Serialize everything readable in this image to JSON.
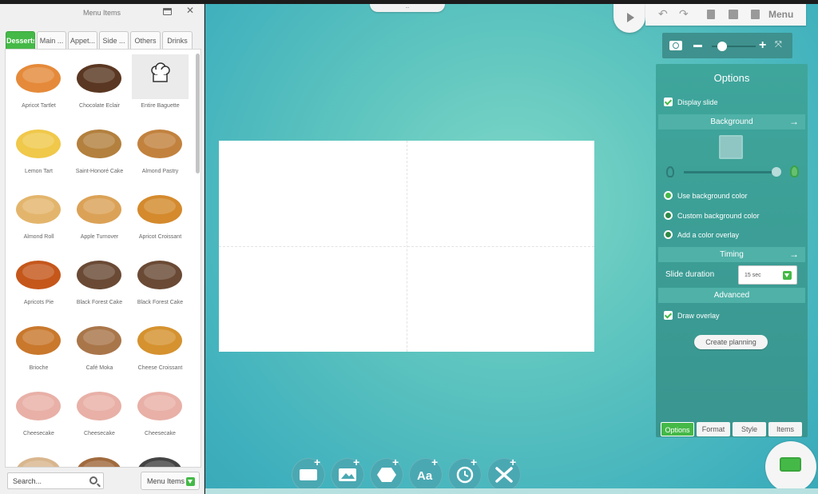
{
  "left_panel": {
    "title": "Menu Items",
    "tabs": [
      {
        "label": "Desserts",
        "active": true
      },
      {
        "label": "Main ..."
      },
      {
        "label": "Appet..."
      },
      {
        "label": "Side ..."
      },
      {
        "label": "Others"
      },
      {
        "label": "Drinks"
      }
    ],
    "items": [
      {
        "name": "Apricot Tartlet",
        "color": "#e58a3a"
      },
      {
        "name": "Chocolate Eclair",
        "color": "#5a3722"
      },
      {
        "name": "Entire Baguette",
        "placeholder": true
      },
      {
        "name": "Lemon Tart",
        "color": "#f0c84a"
      },
      {
        "name": "Saint-Honoré Cake",
        "color": "#b3803e"
      },
      {
        "name": "Almond Pastry",
        "color": "#c2823e"
      },
      {
        "name": "Almond Roll",
        "color": "#e3b56c"
      },
      {
        "name": "Apple Turnover",
        "color": "#dba257"
      },
      {
        "name": "Apricot Croissant",
        "color": "#d48a2d"
      },
      {
        "name": "Apricots Pie",
        "color": "#c5571b"
      },
      {
        "name": "Black Forest Cake",
        "color": "#6a4a35"
      },
      {
        "name": "Black Forest Cake",
        "color": "#6a4a35"
      },
      {
        "name": "Brioche",
        "color": "#c9782c"
      },
      {
        "name": "Café Moka",
        "color": "#a9764a"
      },
      {
        "name": "Cheese Croissant",
        "color": "#d5922f"
      },
      {
        "name": "Cheesecake",
        "color": "#e8b0a7"
      },
      {
        "name": "Cheesecake",
        "color": "#e8b0a7"
      },
      {
        "name": "Cheesecake",
        "color": "#e8b0a7"
      },
      {
        "name": "",
        "color": "#d8b68e"
      },
      {
        "name": "",
        "color": "#a06a3e"
      },
      {
        "name": "",
        "color": "#444444"
      }
    ],
    "search_placeholder": "Search...",
    "filter_select": "Menu Items"
  },
  "toolbar": {
    "menu_label": "Menu",
    "top_tab": "..."
  },
  "options": {
    "title": "Options",
    "display_slide": "Display slide",
    "background_section": "Background",
    "use_bg_color": "Use background color",
    "custom_bg_color": "Custom background color",
    "add_color_overlay": "Add a color overlay",
    "timing_section": "Timing",
    "slide_duration_label": "Slide duration",
    "slide_duration_value": "15 sec",
    "advanced_section": "Advanced",
    "draw_overlay": "Draw overlay",
    "create_planning": "Create planning",
    "tabs": [
      {
        "label": "Options",
        "active": true
      },
      {
        "label": "Format"
      },
      {
        "label": "Style"
      },
      {
        "label": "Items"
      }
    ]
  },
  "colors": {
    "accent_green": "#44b947",
    "panel_teal": "#3fa69c"
  }
}
